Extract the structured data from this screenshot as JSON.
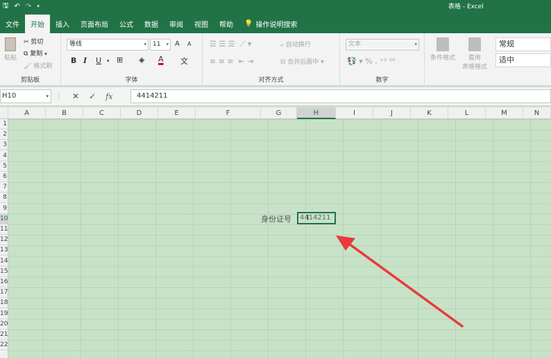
{
  "titlebar": {
    "title": "表格 - Excel",
    "qat": {
      "save": "🖫",
      "undo": "↶",
      "redo": "↷"
    }
  },
  "tabs": [
    "文件",
    "开始",
    "插入",
    "页面布局",
    "公式",
    "数据",
    "审阅",
    "视图",
    "帮助"
  ],
  "tell_me": "操作说明搜索",
  "ribbon": {
    "clipboard": {
      "paste": "粘贴",
      "cut": "剪切",
      "copy": "复制",
      "format_painter": "格式刷",
      "label": "剪贴板"
    },
    "font": {
      "name": "等线",
      "size": "11",
      "grow": "A",
      "shrink": "A",
      "bold": "B",
      "italic": "I",
      "underline": "U",
      "color_a": "A",
      "label": "字体"
    },
    "alignment": {
      "wrap": "自动换行",
      "merge": "合并后居中",
      "label": "对齐方式"
    },
    "number": {
      "format": "文本",
      "percent": "%",
      "comma": ",",
      "label": "数字"
    },
    "styles": {
      "cond_format": "条件格式",
      "table_format_1": "套用",
      "table_format_2": "表格格式",
      "normal": "常规",
      "neutral": "适中"
    }
  },
  "formula_bar": {
    "name_box": "H10",
    "cancel": "✕",
    "enter": "✓",
    "fx": "fx",
    "value": "4414211"
  },
  "columns": [
    "A",
    "B",
    "C",
    "D",
    "E",
    "F",
    "G",
    "H",
    "I",
    "J",
    "K",
    "L",
    "M",
    "N"
  ],
  "selected_column": "H",
  "rows": [
    "1",
    "2",
    "3",
    "4",
    "5",
    "6",
    "7",
    "8",
    "9",
    "10",
    "11",
    "12",
    "13",
    "14",
    "15",
    "16",
    "17",
    "18",
    "19",
    "20",
    "21",
    "22"
  ],
  "selected_row": "10",
  "cells": {
    "G10": "身份证号",
    "H10": "4414211"
  },
  "colors": {
    "brand": "#217346",
    "sheet_bg": "#c8e2c8",
    "annotation_arrow": "#e83a3a"
  }
}
